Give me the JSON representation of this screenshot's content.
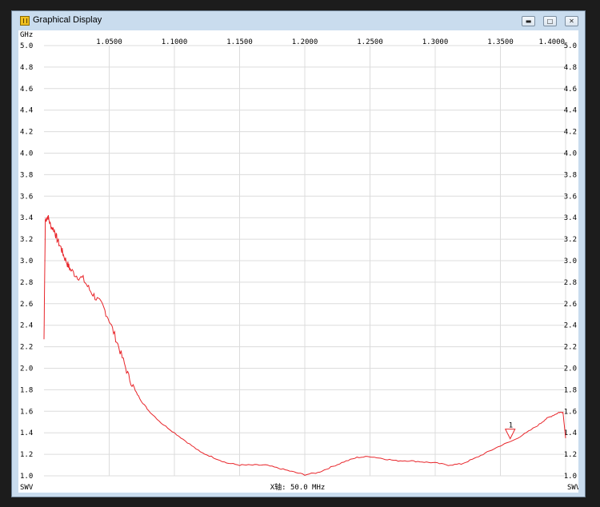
{
  "window": {
    "title": "Graphical Display",
    "icon": "antenna-icon",
    "controls": {
      "minimize": "minimize-icon",
      "maximize": "maximize-icon",
      "close": "close-icon"
    }
  },
  "plot": {
    "x_unit": "GHz",
    "y_unit": "SWV",
    "x_span_label": "X轴: 50.0 MHz",
    "marker_label": "1",
    "colors": {
      "trace": "#e8252a",
      "grid": "#dcdcdc",
      "background": "#ffffff",
      "window": "#c9dcee"
    }
  },
  "chart_data": {
    "type": "line",
    "xlim": [
      1.0,
      1.4
    ],
    "ylim": [
      1.0,
      5.0
    ],
    "x_ticks": [
      "1.0500",
      "1.1000",
      "1.1500",
      "1.2000",
      "1.2500",
      "1.3000",
      "1.3500",
      "1.4000"
    ],
    "x_tick_values": [
      1.05,
      1.1,
      1.15,
      1.2,
      1.25,
      1.3,
      1.35,
      1.4
    ],
    "y_ticks": [
      "5.0",
      "4.8",
      "4.6",
      "4.4",
      "4.2",
      "4.0",
      "3.8",
      "3.6",
      "3.4",
      "3.2",
      "3.0",
      "2.8",
      "2.6",
      "2.4",
      "2.2",
      "2.0",
      "1.8",
      "1.6",
      "1.4",
      "1.2",
      "1.0"
    ],
    "grid": true,
    "marker": {
      "x": 1.3575,
      "y": 1.33
    },
    "series": [
      {
        "x": [
          1.0,
          1.001,
          1.003,
          1.005,
          1.008,
          1.01,
          1.013,
          1.015,
          1.018,
          1.02,
          1.025,
          1.03,
          1.035,
          1.04,
          1.045,
          1.05,
          1.055,
          1.06,
          1.065,
          1.07,
          1.075,
          1.08,
          1.09,
          1.1,
          1.11,
          1.12,
          1.13,
          1.14,
          1.15,
          1.16,
          1.17,
          1.18,
          1.19,
          1.2,
          1.21,
          1.22,
          1.23,
          1.24,
          1.25,
          1.26,
          1.27,
          1.28,
          1.29,
          1.3,
          1.31,
          1.32,
          1.33,
          1.34,
          1.35,
          1.36,
          1.37,
          1.38,
          1.385,
          1.39,
          1.395,
          1.398,
          1.4
        ],
        "y": [
          2.27,
          3.38,
          3.41,
          3.33,
          3.28,
          3.2,
          3.12,
          3.05,
          2.97,
          2.92,
          2.86,
          2.83,
          2.73,
          2.65,
          2.58,
          2.45,
          2.28,
          2.1,
          1.92,
          1.79,
          1.69,
          1.61,
          1.49,
          1.4,
          1.31,
          1.22,
          1.17,
          1.12,
          1.1,
          1.1,
          1.1,
          1.07,
          1.04,
          1.01,
          1.03,
          1.08,
          1.13,
          1.17,
          1.18,
          1.16,
          1.14,
          1.14,
          1.13,
          1.12,
          1.1,
          1.11,
          1.16,
          1.22,
          1.28,
          1.33,
          1.4,
          1.48,
          1.53,
          1.56,
          1.59,
          1.59,
          1.35
        ]
      }
    ]
  }
}
